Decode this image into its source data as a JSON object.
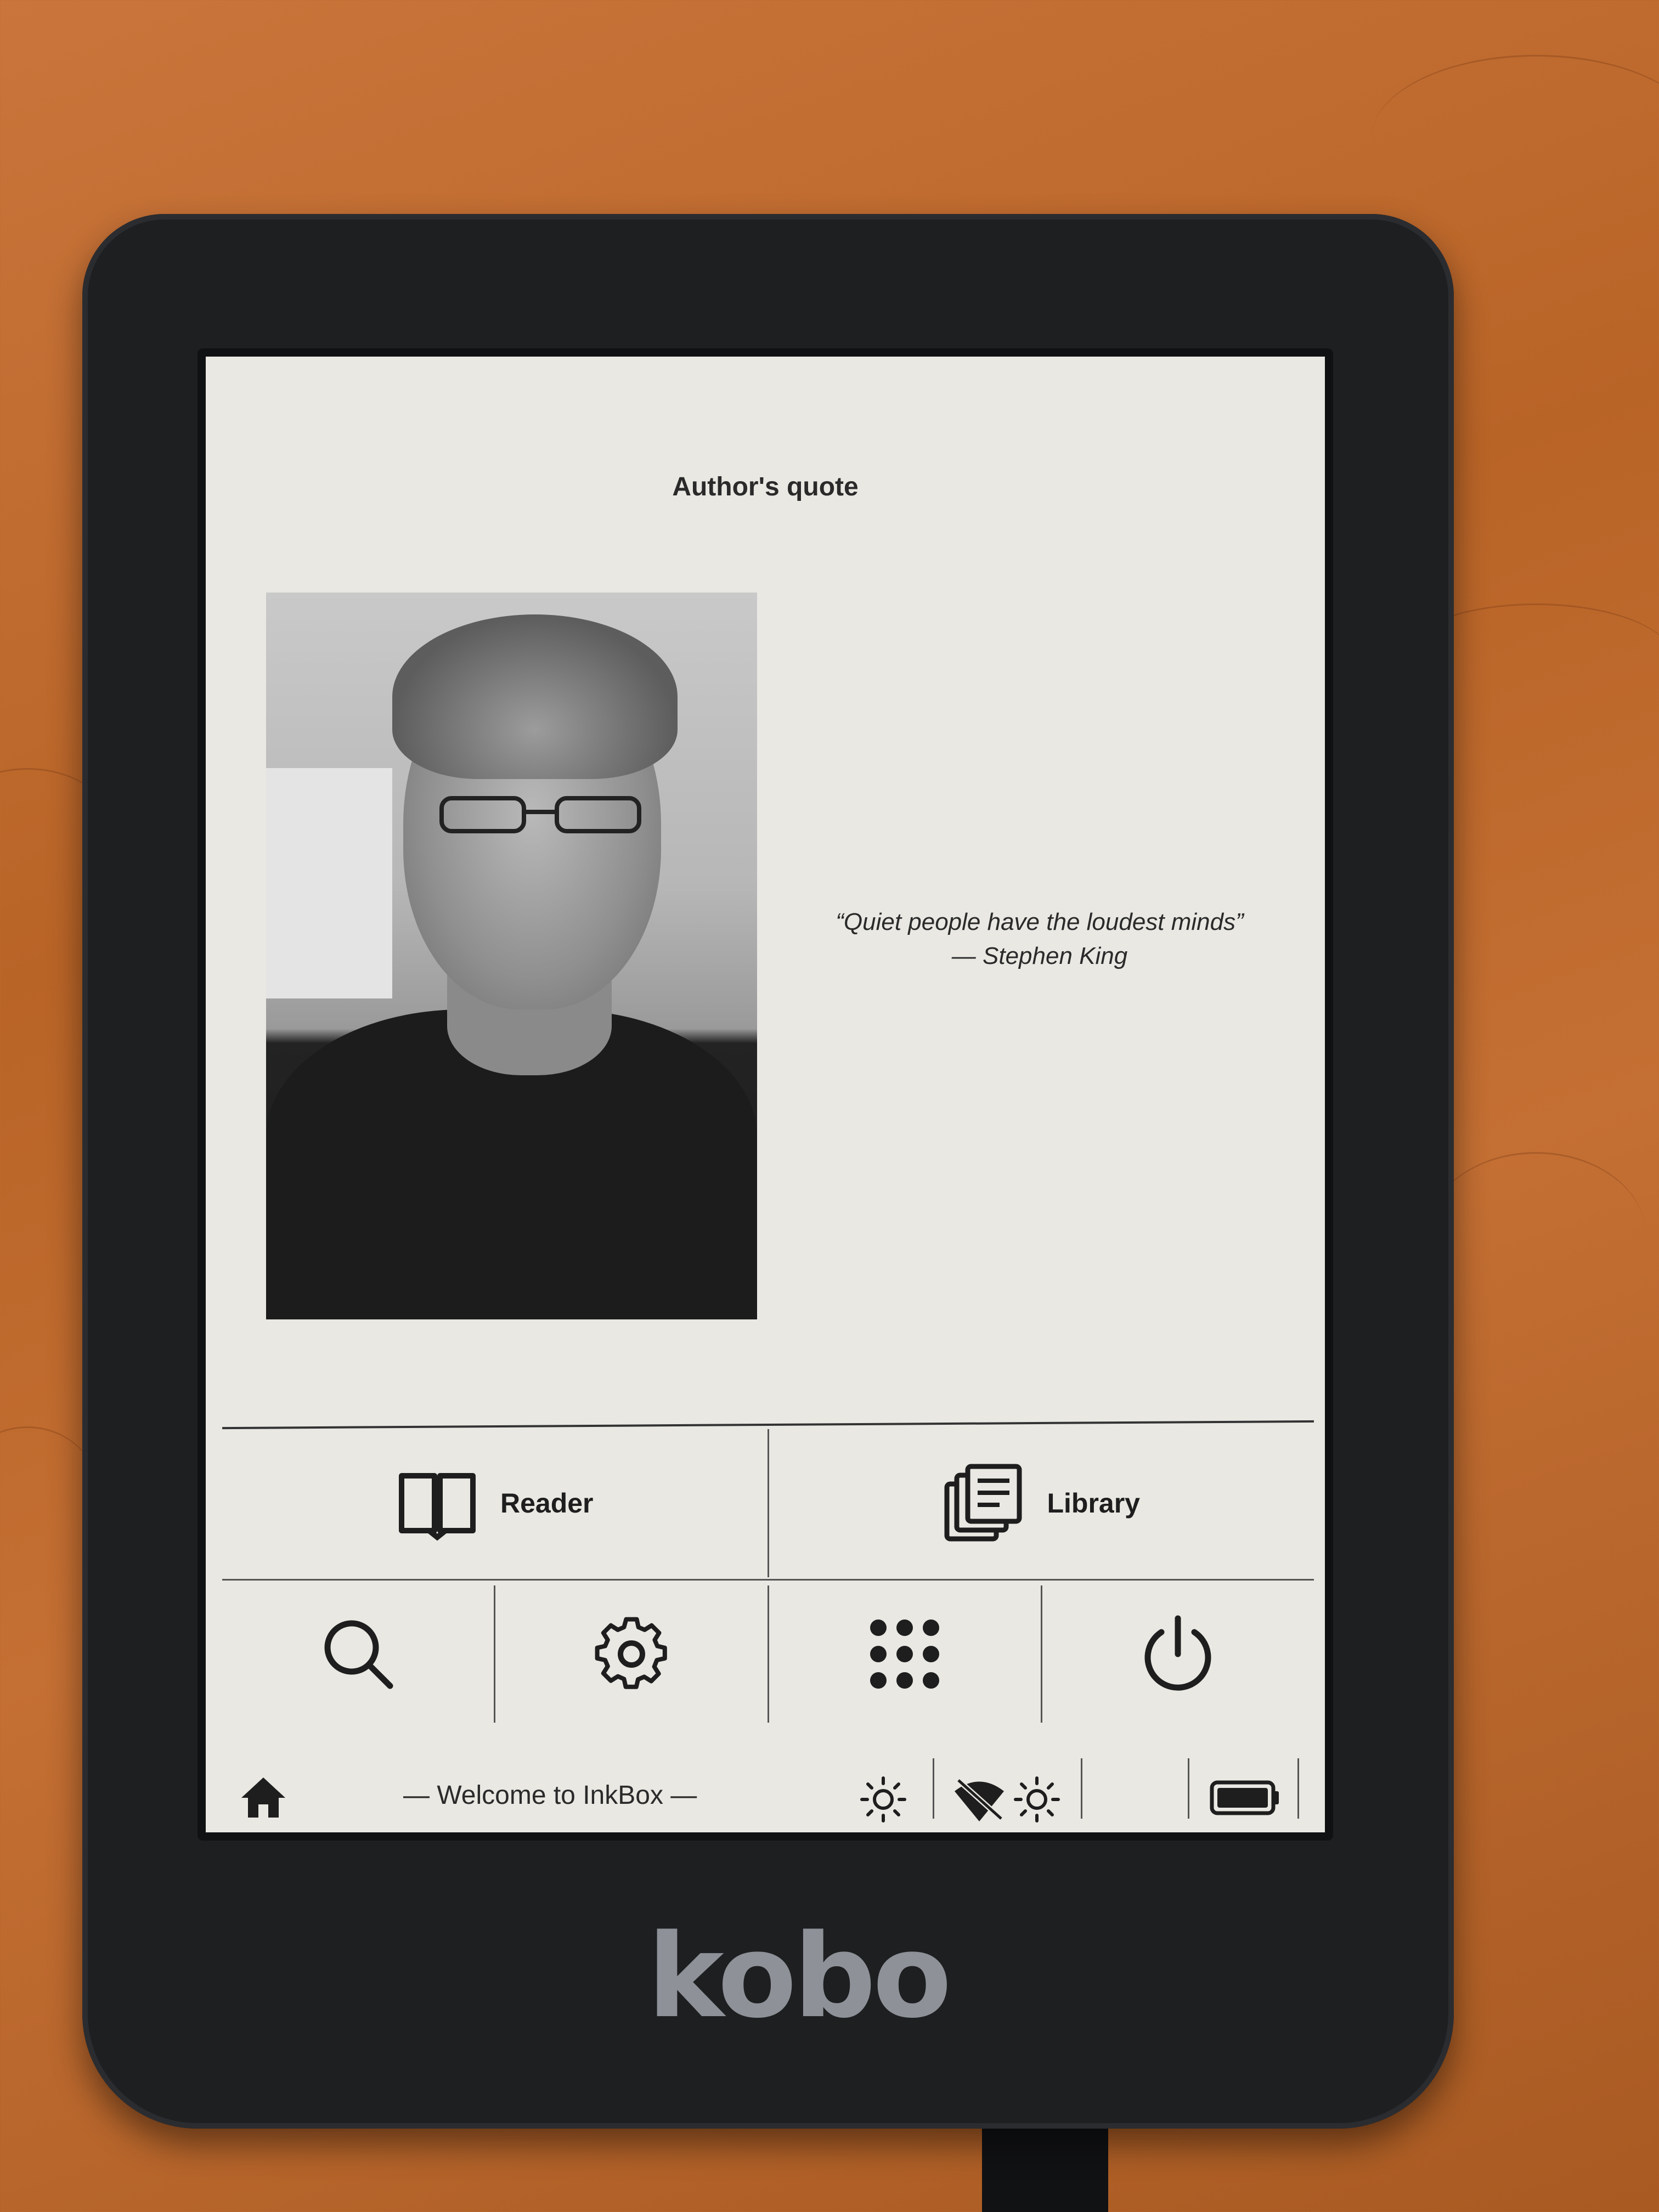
{
  "device": {
    "brand": "kobo"
  },
  "screen": {
    "title": "Author's quote",
    "quote_text": "“Quiet people have the loudest minds”",
    "quote_author": "— Stephen King"
  },
  "menu": {
    "reader_label": "Reader",
    "library_label": "Library",
    "icons": [
      "search-icon",
      "settings-icon",
      "apps-grid-icon",
      "power-icon"
    ]
  },
  "status_bar": {
    "welcome_text": "— Welcome to InkBox —",
    "icons": [
      "home-icon",
      "brightness-icon",
      "wifi-off-icon",
      "warmth-icon",
      "battery-icon"
    ]
  },
  "colors": {
    "screen_bg": "#e9e8e3",
    "bezel": "#1e1f21",
    "ink": "#1e1e1e"
  }
}
